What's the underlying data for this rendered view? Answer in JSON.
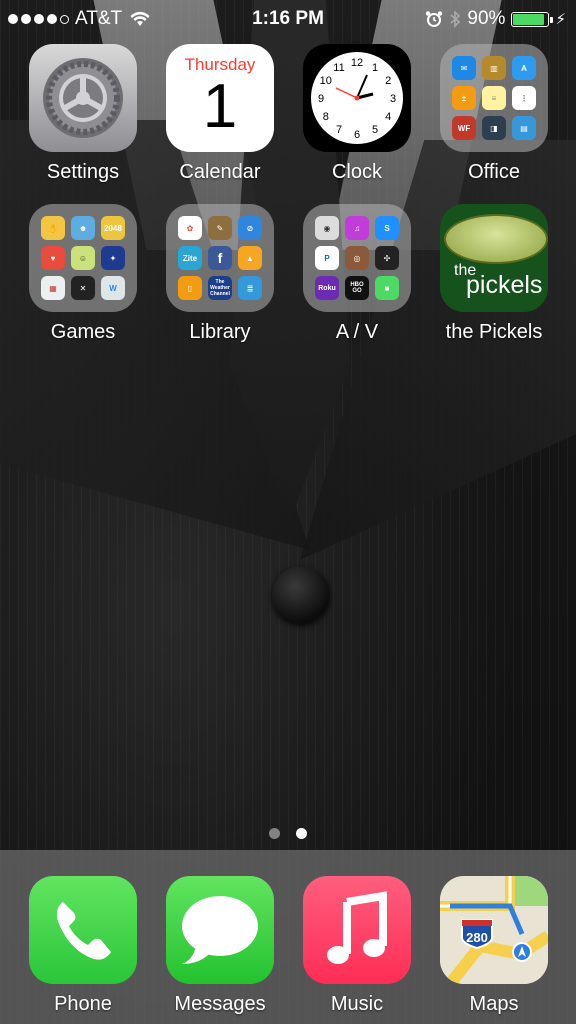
{
  "status_bar": {
    "carrier": "AT&T",
    "time": "1:16 PM",
    "battery_percent": "90%",
    "battery_level": 0.9
  },
  "apps": {
    "settings": "Settings",
    "calendar": "Calendar",
    "calendar_day": "Thursday",
    "calendar_date": "1",
    "clock": "Clock",
    "office": "Office",
    "games": "Games",
    "library": "Library",
    "av": "A / V",
    "pickels": "the Pickels",
    "pickels_icon_top": "the",
    "pickels_icon_bottom": "pickels"
  },
  "clock_numbers": [
    "12",
    "1",
    "2",
    "3",
    "4",
    "5",
    "6",
    "7",
    "8",
    "9",
    "10",
    "11"
  ],
  "folder_contents": {
    "games_tile_2048": "2048",
    "library_tile_zite": "Zite",
    "library_tile_weather": "The Weather Channel",
    "av_tile_roku": "Roku",
    "av_tile_hbo": "HBO GO",
    "office_tile_wf": "WF"
  },
  "pager": {
    "pages": 2,
    "active": 2
  },
  "dock": {
    "phone": "Phone",
    "messages": "Messages",
    "music": "Music",
    "maps": "Maps",
    "maps_shield": "280"
  },
  "colors": {
    "calendar_red": "#ff3b30",
    "battery_green": "#4cd964",
    "music_pink": "#ff2d55",
    "phone_green": "#2ac63a"
  }
}
